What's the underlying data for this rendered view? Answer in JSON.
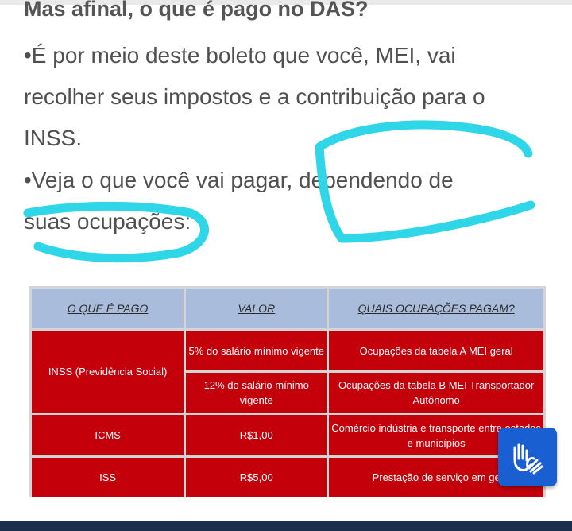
{
  "heading": "Mas afinal, o que é pago no DAS?",
  "paragraphs": [
    "•É por meio deste boleto que você, MEI, vai",
    "recolher seus impostos e a contribuição para o",
    "INSS.",
    "•Veja o que você vai pagar, dependendo de",
    "suas ocupações:"
  ],
  "table": {
    "headers": [
      "O QUE É PAGO",
      "VALOR",
      "QUAIS OCUPAÇÕES PAGAM?"
    ],
    "rows": [
      {
        "tax": "INSS (Previdência Social)",
        "value": "5% do salário mínimo vigente",
        "occupations": "Ocupações da tabela A MEI geral"
      },
      {
        "tax": "",
        "value": "12% do salário mínimo vigente",
        "occupations": "Ocupações da tabela B MEI Transportador Autônomo"
      },
      {
        "tax": "ICMS",
        "value": "R$1,00",
        "occupations": "Comércio indústria e transporte entre estados e municípios"
      },
      {
        "tax": "ISS",
        "value": "R$5,00",
        "occupations": "Prestação de serviço em ge"
      }
    ]
  },
  "colors": {
    "accent_cell": "#c4000b",
    "header_cell": "#a9bcdc",
    "highlight_stroke": "#2ed6e8",
    "button": "#1a5fd1"
  },
  "accessibility_button": {
    "icon": "sign-language-hands-icon"
  }
}
